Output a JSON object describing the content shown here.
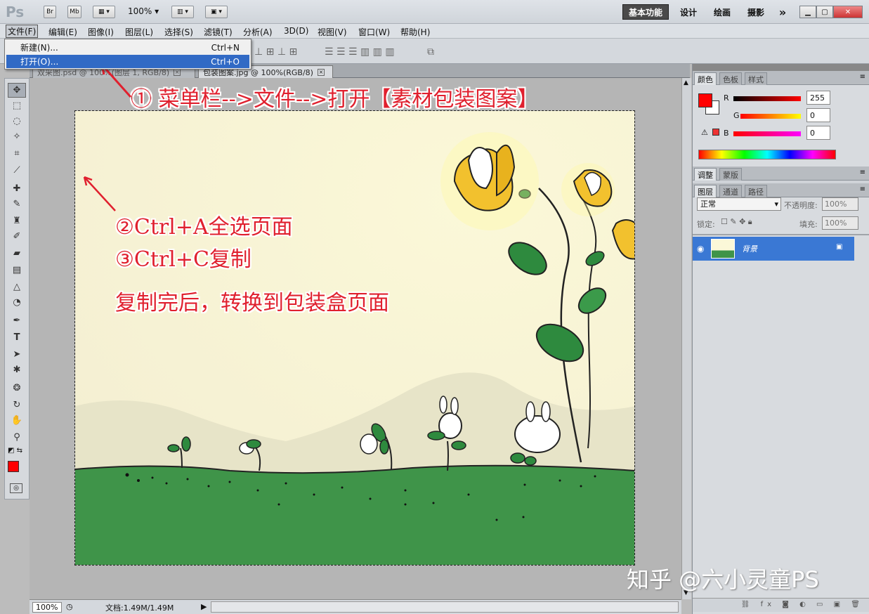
{
  "app": {
    "logo": "Ps",
    "zoom": "100%"
  },
  "titlebar": {
    "bridge": "Br",
    "minibridge": "Mb",
    "workspaces": [
      "基本功能",
      "设计",
      "绘画",
      "摄影"
    ],
    "more": "»"
  },
  "menubar": {
    "items": [
      "文件(F)",
      "编辑(E)",
      "图像(I)",
      "图层(L)",
      "选择(S)",
      "滤镜(T)",
      "分析(A)",
      "3D(D)",
      "视图(V)",
      "窗口(W)",
      "帮助(H)"
    ]
  },
  "dropdown": {
    "items": [
      {
        "label": "新建(N)...",
        "shortcut": "Ctrl+N"
      },
      {
        "label": "打开(O)...",
        "shortcut": "Ctrl+O"
      }
    ]
  },
  "tabs": [
    {
      "label": "双采图.psd @ 100%(图层 1, RGB/8)",
      "active": false
    },
    {
      "label": "包装图案.jpg @ 100%(RGB/8)",
      "active": true
    }
  ],
  "annotations": {
    "step1": "① 菜单栏-->文件-->打开【素材包装图案】",
    "step2": "②Ctrl+A全选页面",
    "step3": "③Ctrl+C复制",
    "step4": "复制完后，转换到包装盒页面",
    "watermark": "知乎 @六小灵童PS"
  },
  "color_panel": {
    "tabs": [
      "颜色",
      "色板",
      "样式"
    ],
    "r_label": "R",
    "g_label": "G",
    "b_label": "B",
    "r": "255",
    "g": "0",
    "b": "0",
    "foreground": "#ff0000"
  },
  "adjust_panel": {
    "tabs": [
      "调整",
      "蒙版"
    ]
  },
  "layers_panel": {
    "tabs": [
      "图层",
      "通道",
      "路径"
    ],
    "blend_mode": "正常",
    "opacity_label": "不透明度:",
    "opacity": "100%",
    "lock_label": "锁定:",
    "fill_label": "填充:",
    "fill": "100%",
    "layer_name": "背景"
  },
  "statusbar": {
    "zoom": "100%",
    "doc_info": "文档:1.49M/1.49M"
  }
}
